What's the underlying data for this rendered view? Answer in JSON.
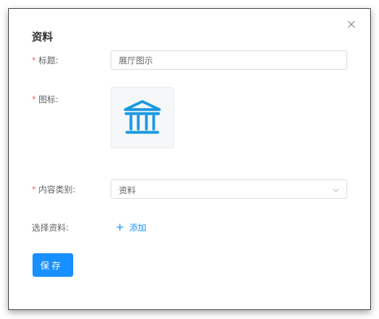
{
  "dialog": {
    "title": "资料",
    "close_icon": "close-icon"
  },
  "form": {
    "required_mark": "*",
    "title_field": {
      "label": "标题:",
      "value": "展厅图示"
    },
    "icon_field": {
      "label": "图标:",
      "icon": "museum-building-icon",
      "icon_color": "#1a98e0"
    },
    "category_field": {
      "label": "内容类别:",
      "value": "资料",
      "arrow_icon": "chevron-down-icon"
    },
    "material_field": {
      "label": "选择资料:",
      "add_label": "添加",
      "add_icon": "plus-icon"
    },
    "save_label": "保存"
  },
  "colors": {
    "primary": "#1890ff",
    "required": "#f56c6c",
    "border": "#dcdfe6"
  }
}
